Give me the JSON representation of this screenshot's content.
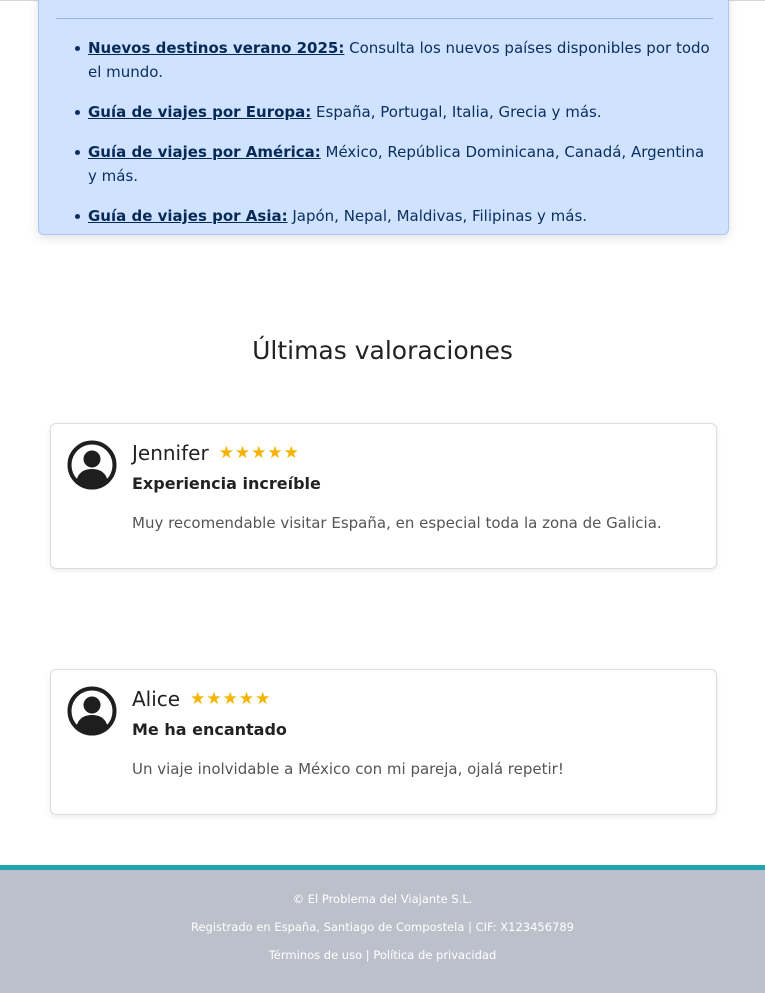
{
  "news": {
    "items": [
      {
        "link": "Nuevos destinos verano 2025:",
        "text": " Consulta los nuevos países disponibles por todo el mundo."
      },
      {
        "link": "Guía de viajes por Europa:",
        "text": " España, Portugal, Italia, Grecia y más."
      },
      {
        "link": "Guía de viajes por América:",
        "text": " México, República Dominicana, Canadá, Argentina y más."
      },
      {
        "link": "Guía de viajes por Asia:",
        "text": " Japón, Nepal, Maldivas, Filipinas y más."
      }
    ]
  },
  "reviews_section": {
    "title": "Últimas valoraciones",
    "reviews": [
      {
        "name": "Jennifer",
        "stars": "★★★★★",
        "rating": 5,
        "title": "Experiencia increíble",
        "text": "Muy recomendable visitar España, en especial toda la zona de Galicia."
      },
      {
        "name": "Alice",
        "stars": "★★★★★",
        "rating": 5,
        "title": "Me ha encantado",
        "text": "Un viaje inolvidable a México con mi pareja, ojalá repetir!"
      }
    ]
  },
  "footer": {
    "copyright": "© El Problema del Viajante S.L.",
    "registry": "Registrado en España, Santiago de Compostela | CIF: X123456789",
    "terms_link": "Términos de uso",
    "separator": " | ",
    "privacy_link": "Política de privacidad"
  },
  "colors": {
    "news_background": "#cfe2ff",
    "star": "#f4b400",
    "footer_background": "#bbc0ca",
    "footer_accent": "#20a3b2"
  },
  "icons": {
    "avatar": "user-avatar-icon"
  }
}
